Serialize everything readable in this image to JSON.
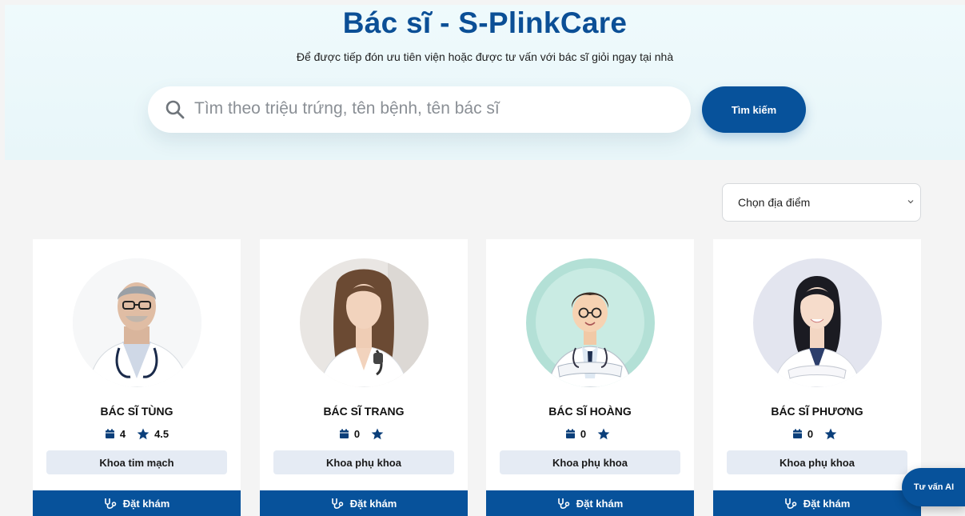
{
  "hero": {
    "title": "Bác sĩ - S-PlinkCare",
    "subtitle": "Để được tiếp đón ưu tiên viện hoặc được tư vấn với bác sĩ giỏi ngay tại nhà"
  },
  "search": {
    "placeholder": "Tìm theo triệu trứng, tên bệnh, tên bác sĩ",
    "button_label": "Tìm kiếm",
    "icon": "search-icon"
  },
  "filter": {
    "location_selected": "Chọn địa điểm"
  },
  "doctors": [
    {
      "name": "BÁC SĨ TÙNG",
      "appointments": "4",
      "rating": "4.5",
      "department": "Khoa tim mạch",
      "book_label": "Đặt khám"
    },
    {
      "name": "BÁC SĨ TRANG",
      "appointments": "0",
      "rating": "",
      "department": "Khoa phụ khoa",
      "book_label": "Đặt khám"
    },
    {
      "name": "BÁC SĨ HOÀNG",
      "appointments": "0",
      "rating": "",
      "department": "Khoa phụ khoa",
      "book_label": "Đặt khám"
    },
    {
      "name": "BÁC SĨ PHƯƠNG",
      "appointments": "0",
      "rating": "",
      "department": "Khoa phụ khoa",
      "book_label": "Đặt khám"
    }
  ],
  "ai_button": {
    "label": "Tư vấn AI"
  },
  "colors": {
    "primary": "#07529b",
    "hero_bg": "#effafc",
    "dept_bg": "#e5ebf4",
    "page_bg": "#f4f4f4"
  },
  "icons": [
    "search-icon",
    "calendar-icon",
    "star-icon",
    "stethoscope-icon",
    "chevron-down-icon"
  ]
}
